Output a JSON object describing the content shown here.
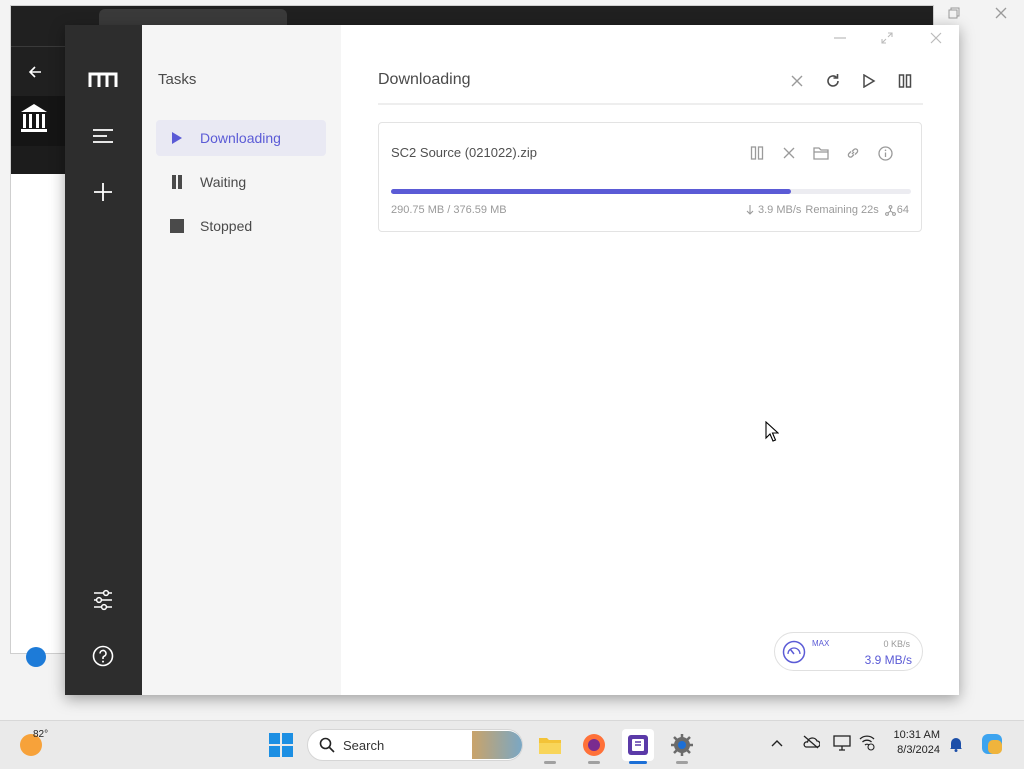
{
  "motrix": {
    "panel_title": "Tasks",
    "nav": [
      {
        "label": "Downloading",
        "active": true,
        "icon": "play-icon"
      },
      {
        "label": "Waiting",
        "active": false,
        "icon": "pause-icon"
      },
      {
        "label": "Stopped",
        "active": false,
        "icon": "stop-icon"
      }
    ],
    "main_title": "Downloading",
    "header_actions": [
      "close-icon",
      "refresh-icon",
      "play-icon",
      "pause-icon"
    ],
    "task": {
      "name": "SC2 Source (021022).zip",
      "progress_percent": 77,
      "size": "290.75 MB / 376.59 MB",
      "speed": "3.9 MB/s",
      "remaining": "Remaining 22s",
      "connections": "64"
    },
    "speed_meter": {
      "limit_label": "MAX",
      "upload": "0 KB/s",
      "download": "3.9 MB/s"
    },
    "accent_color": "#5b5bd6"
  },
  "taskbar": {
    "temperature": "82°",
    "search_placeholder": "Search",
    "time": "10:31 AM",
    "date": "8/3/2024"
  }
}
